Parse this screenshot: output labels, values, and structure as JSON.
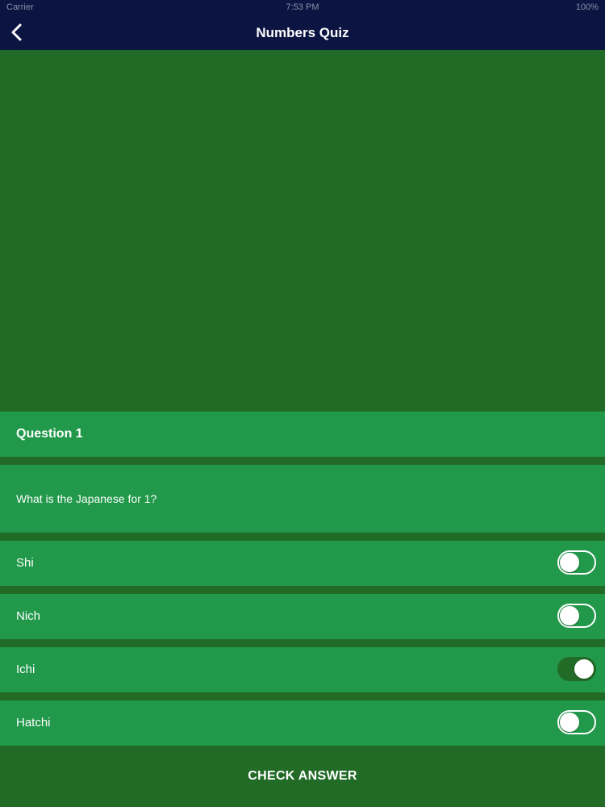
{
  "status_bar": {
    "carrier": "Carrier",
    "time": "7:53 PM",
    "battery": "100%"
  },
  "nav": {
    "title": "Numbers Quiz",
    "back_icon": "chevron-left-icon"
  },
  "quiz": {
    "question_header": "Question 1",
    "question_text": "What is the Japanese for 1?",
    "answers": [
      {
        "label": "Shi",
        "selected": false
      },
      {
        "label": "Nich",
        "selected": false
      },
      {
        "label": "Ichi",
        "selected": true
      },
      {
        "label": "Hatchi",
        "selected": false
      }
    ],
    "check_button_label": "CHECK ANSWER"
  },
  "colors": {
    "nav_background": "#0c1542",
    "page_background": "#226b27",
    "row_background": "#21984a",
    "text": "#ffffff"
  }
}
